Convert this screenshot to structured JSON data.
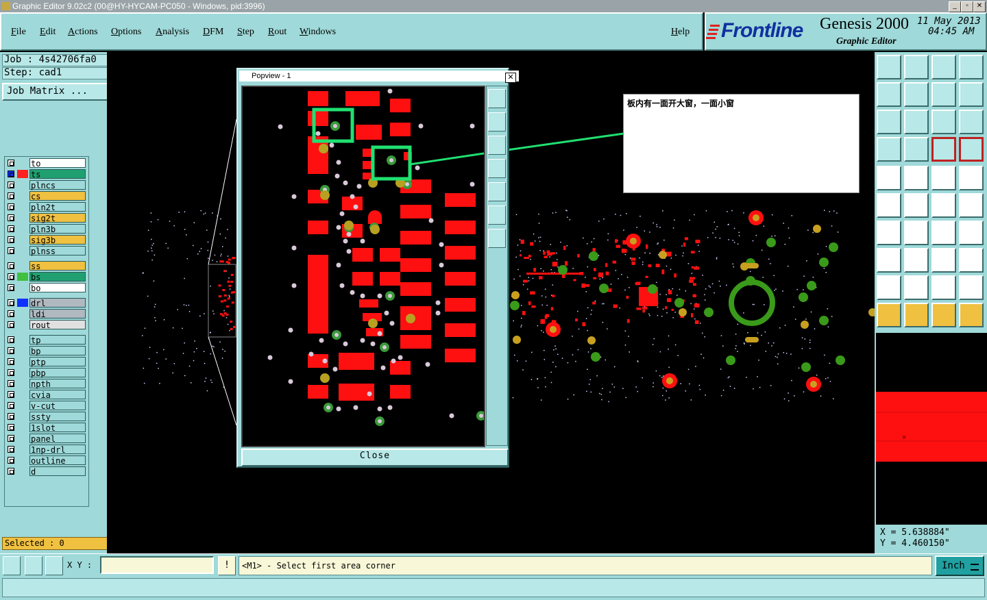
{
  "window": {
    "title": "Graphic Editor 9.02c2 (00@HY-HYCAM-PC050 - Windows, pid:3996)",
    "buttons": [
      "_",
      "▫",
      "✕"
    ]
  },
  "menu": [
    "File",
    "Edit",
    "Actions",
    "Options",
    "Analysis",
    "DFM",
    "Step",
    "Rout",
    "Windows"
  ],
  "help": "Help",
  "brand": {
    "logo": "Frontline",
    "product": "Genesis 2000",
    "subtitle": "Graphic Editor",
    "date": "11 May 2013",
    "time": "04:45 AM"
  },
  "job": {
    "job_label": "Job : 4s42706fa0",
    "step_label": "Step: cad1",
    "matrix_button": "Job Matrix ..."
  },
  "layers": [
    {
      "name": "to",
      "bg": "#ffffff",
      "swatch": "#ffffff"
    },
    {
      "name": "ts",
      "bg": "#20a070",
      "swatch": "#ff2020",
      "active": true
    },
    {
      "name": "plncs",
      "bg": "#9fd9d9",
      "swatch": "#ffffff"
    },
    {
      "name": "cs",
      "bg": "#f0c040",
      "swatch": "#ffffff"
    },
    {
      "name": "pln2t",
      "bg": "#9fd9d9",
      "swatch": "#ffffff"
    },
    {
      "name": "sig2t",
      "bg": "#f0c040",
      "swatch": "#ffffff"
    },
    {
      "name": "pln3b",
      "bg": "#9fd9d9",
      "swatch": "#ffffff"
    },
    {
      "name": "sig3b",
      "bg": "#f0c040",
      "swatch": "#ffffff"
    },
    {
      "name": "plnss",
      "bg": "#9fd9d9",
      "swatch": "#ffffff"
    },
    {
      "name": "ss",
      "bg": "#f0c040",
      "swatch": "#ffffff"
    },
    {
      "name": "bs",
      "bg": "#20a070",
      "swatch": "#40c040"
    },
    {
      "name": "bo",
      "bg": "#ffffff",
      "swatch": "#ffffff"
    },
    {
      "name": "drl",
      "bg": "#b0b8c0",
      "swatch": "#1030ff"
    },
    {
      "name": "ldi",
      "bg": "#b0b8c0",
      "swatch": "#ffffff"
    },
    {
      "name": "rout",
      "bg": "#e0e0e0",
      "swatch": "#ffffff"
    },
    {
      "name": "tp",
      "bg": "#9fd9d9",
      "swatch": "#ffffff"
    },
    {
      "name": "bp",
      "bg": "#9fd9d9",
      "swatch": "#ffffff"
    },
    {
      "name": "ptp",
      "bg": "#9fd9d9",
      "swatch": "#ffffff"
    },
    {
      "name": "pbp",
      "bg": "#9fd9d9",
      "swatch": "#ffffff"
    },
    {
      "name": "npth",
      "bg": "#9fd9d9",
      "swatch": "#ffffff"
    },
    {
      "name": "cvia",
      "bg": "#9fd9d9",
      "swatch": "#ffffff"
    },
    {
      "name": "v-cut",
      "bg": "#9fd9d9",
      "swatch": "#ffffff"
    },
    {
      "name": "ssty",
      "bg": "#9fd9d9",
      "swatch": "#ffffff"
    },
    {
      "name": "1slot",
      "bg": "#9fd9d9",
      "swatch": "#ffffff"
    },
    {
      "name": "panel",
      "bg": "#9fd9d9",
      "swatch": "#ffffff"
    },
    {
      "name": "1np-drl",
      "bg": "#9fd9d9",
      "swatch": "#ffffff"
    },
    {
      "name": "outline",
      "bg": "#9fd9d9",
      "swatch": "#ffffff"
    },
    {
      "name": "d",
      "bg": "#9fd9d9",
      "swatch": "#ffffff"
    }
  ],
  "selected": "Selected : 0",
  "popview": {
    "title": "Popview - 1",
    "close": "Close"
  },
  "annotation": "板内有一面开大窗，一面小窗",
  "coords": {
    "x": "X = 5.638884\"",
    "y": "Y = 4.460150\""
  },
  "bottom": {
    "xy_label": "X Y :",
    "xy_value": "",
    "prompt": "<M1> - Select first area corner",
    "unit": "Inch"
  },
  "colors": {
    "panel": "#9fd9d9",
    "pad_red": "#ff1010",
    "via_green": "#3a9a1a",
    "via_yellow": "#c8a020",
    "highlight": "#20e070"
  }
}
